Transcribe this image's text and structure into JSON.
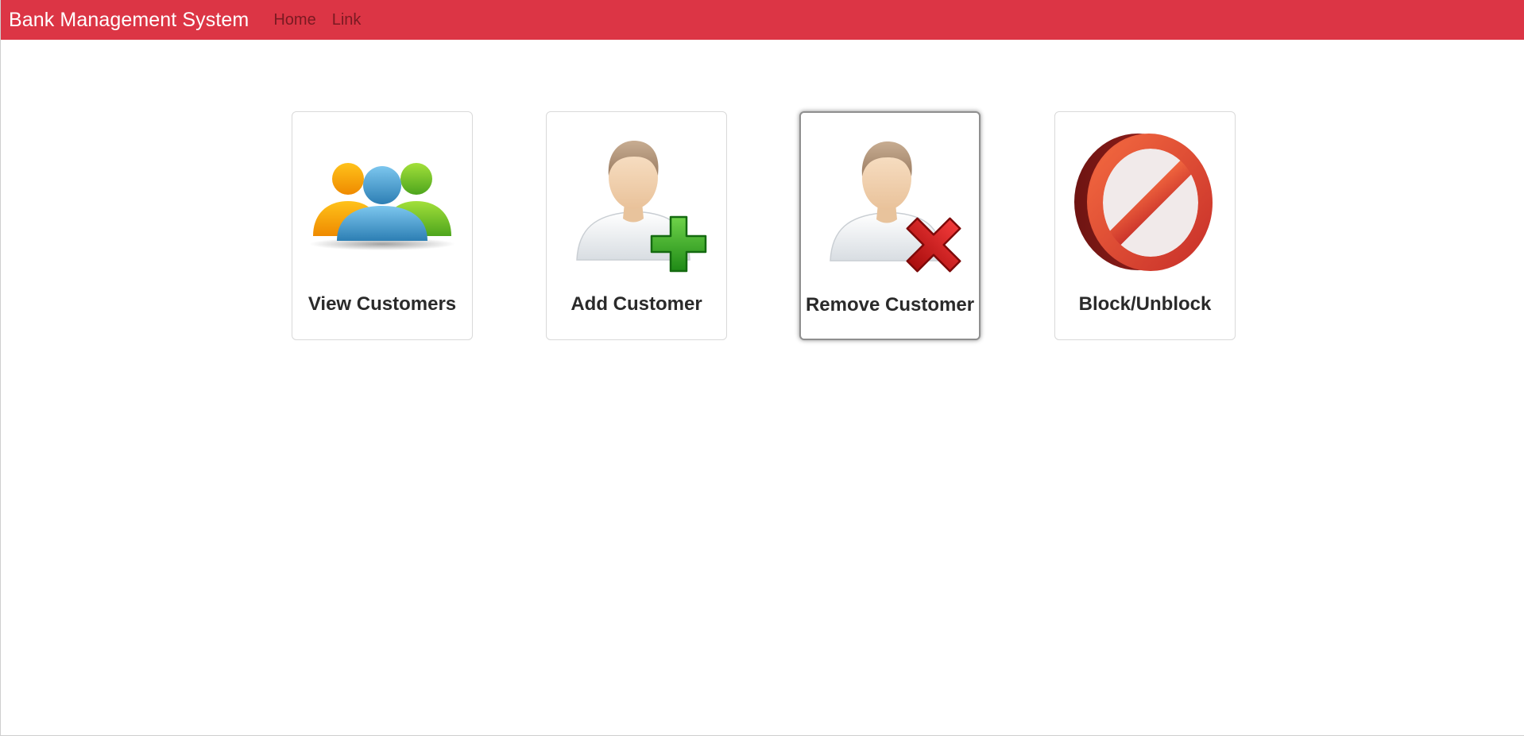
{
  "navbar": {
    "brand": "Bank Management System",
    "links": [
      "Home",
      "Link"
    ],
    "background": "#dc3545"
  },
  "tiles": [
    {
      "label": "View Customers",
      "icon": "users-group-icon",
      "focused": false
    },
    {
      "label": "Add Customer",
      "icon": "add-user-icon",
      "focused": false
    },
    {
      "label": "Remove Customer",
      "icon": "remove-user-icon",
      "focused": true
    },
    {
      "label": "Block/Unblock",
      "icon": "block-icon",
      "focused": false
    }
  ]
}
